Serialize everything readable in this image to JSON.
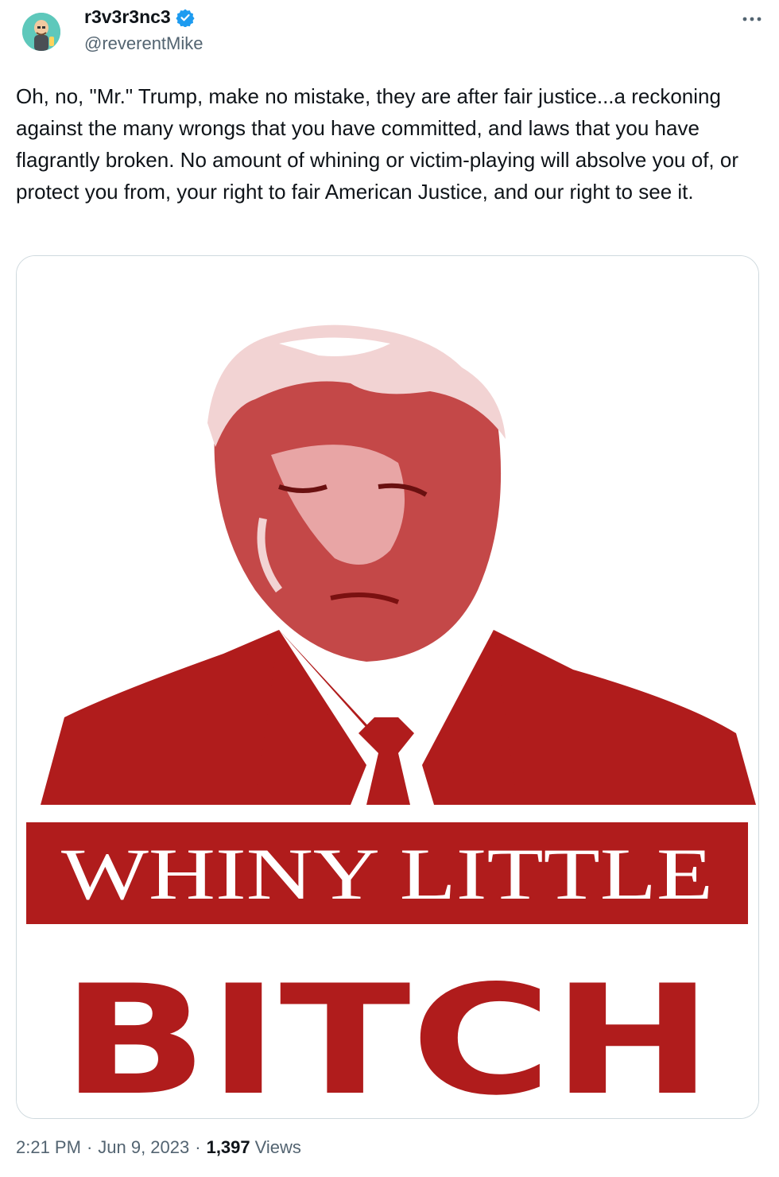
{
  "author": {
    "display_name": "r3v3r3nc3",
    "handle": "@reverentMike",
    "verified": true,
    "avatar_icon": "cartoon-avatar-icon"
  },
  "tweet": {
    "text": "Oh, no, \"Mr.\" Trump, make no mistake, they are after fair justice...a reckoning against the many wrongs that you have committed, and laws that you have flagrantly broken. No amount of whining or victim-playing will absolve you of, or protect you from, your right to fair American Justice, and our right to see it."
  },
  "media": {
    "banner_line1": "WHINY LITTLE",
    "banner_line2": "BITCH",
    "colors": {
      "red": "#b01c1c",
      "light_red": "#e8a5a5",
      "pink": "#f2d3d3"
    }
  },
  "meta": {
    "time": "2:21 PM",
    "date": "Jun 9, 2023",
    "views_count": "1,397",
    "views_label": "Views"
  },
  "icons": {
    "verified": "verified-badge-icon",
    "more": "more-options-icon"
  }
}
